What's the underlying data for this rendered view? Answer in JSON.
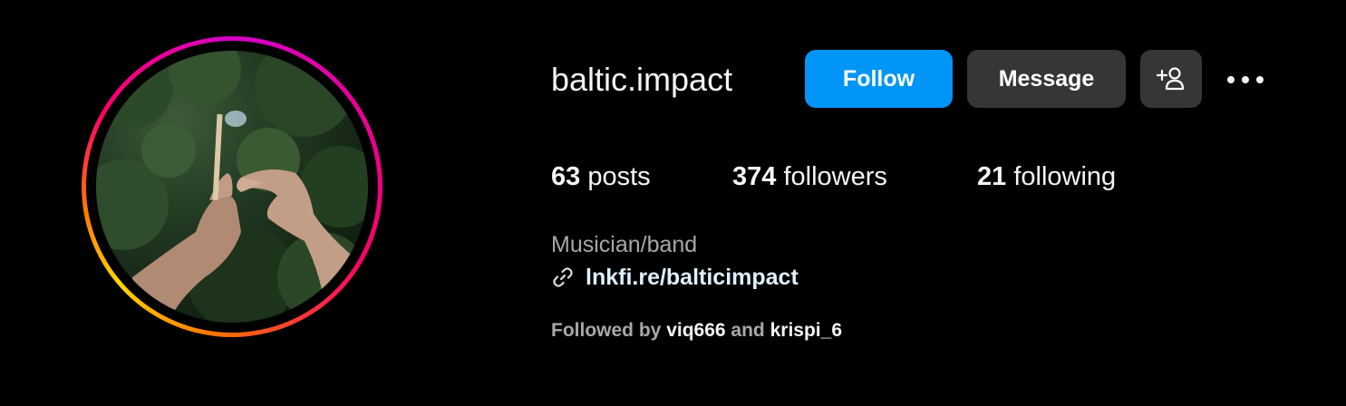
{
  "profile": {
    "username": "baltic.impact",
    "avatar_icon": "profile-photo",
    "ring_colors": [
      "#d300c5",
      "#ff0069",
      "#ff7a00",
      "#ffd600"
    ]
  },
  "actions": {
    "follow_label": "Follow",
    "message_label": "Message",
    "add_user_icon": "add-person-icon",
    "more_icon": "ellipsis-icon",
    "follow_color": "#0095f6",
    "secondary_color": "#363636"
  },
  "stats": {
    "posts": {
      "count": "63",
      "label": "posts"
    },
    "followers": {
      "count": "374",
      "label": "followers"
    },
    "following": {
      "count": "21",
      "label": "following"
    }
  },
  "bio": {
    "category": "Musician/band",
    "link_icon": "chain-link-icon",
    "link": "lnkfi.re/balticimpact"
  },
  "followed_by": {
    "prefix": "Followed by",
    "first": "viq666",
    "conjunction": "and",
    "second": "krispi_6"
  }
}
